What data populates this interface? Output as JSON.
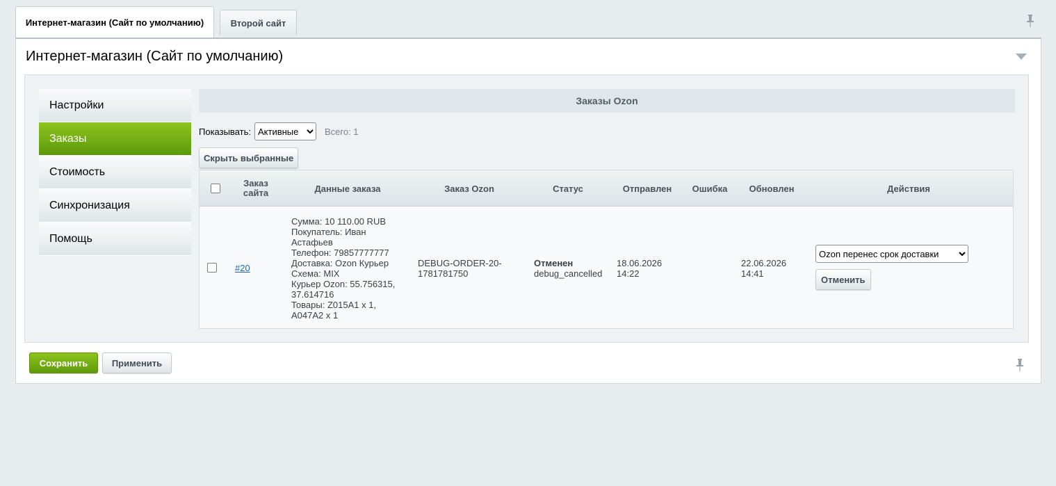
{
  "tabs": [
    {
      "label": "Интернет-магазин (Сайт по умолчанию)"
    },
    {
      "label": "Второй сайт"
    }
  ],
  "panel": {
    "title": "Интернет-магазин (Сайт по умолчанию)"
  },
  "menu": {
    "items": [
      {
        "label": "Настройки"
      },
      {
        "label": "Заказы"
      },
      {
        "label": "Стоимость"
      },
      {
        "label": "Синхронизация"
      },
      {
        "label": "Помощь"
      }
    ]
  },
  "grid": {
    "title": "Заказы Ozon",
    "filter_label": "Показывать:",
    "filter_value": "Активные",
    "total": "Всего: 1",
    "hide_button": "Скрыть выбранные",
    "columns": {
      "site_order": "Заказ сайта",
      "order_data": "Данные заказа",
      "ozon_order": "Заказ Ozon",
      "status": "Статус",
      "sent": "Отправлен",
      "error": "Ошибка",
      "updated": "Обновлен",
      "actions": "Действия"
    },
    "rows": [
      {
        "site_order": "#20",
        "order_data": [
          "Сумма: 10 110.00 RUB",
          "Покупатель: Иван",
          "Астафьев",
          "Телефон: 79857777777",
          "Доставка: Ozon Курьер",
          "Схема: MIX",
          "Курьер Ozon: 55.756315,",
          "37.614716",
          "Товары: Z015A1 x 1,",
          "A047A2 x 1"
        ],
        "ozon_order": [
          "DEBUG-ORDER-20-",
          "1781781750"
        ],
        "status": "Отменен",
        "status_code": "debug_cancelled",
        "sent": [
          "18.06.2026",
          "14:22"
        ],
        "error": "",
        "updated": [
          "22.06.2026",
          "14:41"
        ],
        "action_select": "Ozon перенес срок доставки",
        "action_button": "Отменить"
      }
    ]
  },
  "footer": {
    "save": "Сохранить",
    "apply": "Применить"
  },
  "colors": {
    "accent_green": "#6aa711",
    "link_blue": "#2067b0",
    "background": "#e7ecee"
  }
}
